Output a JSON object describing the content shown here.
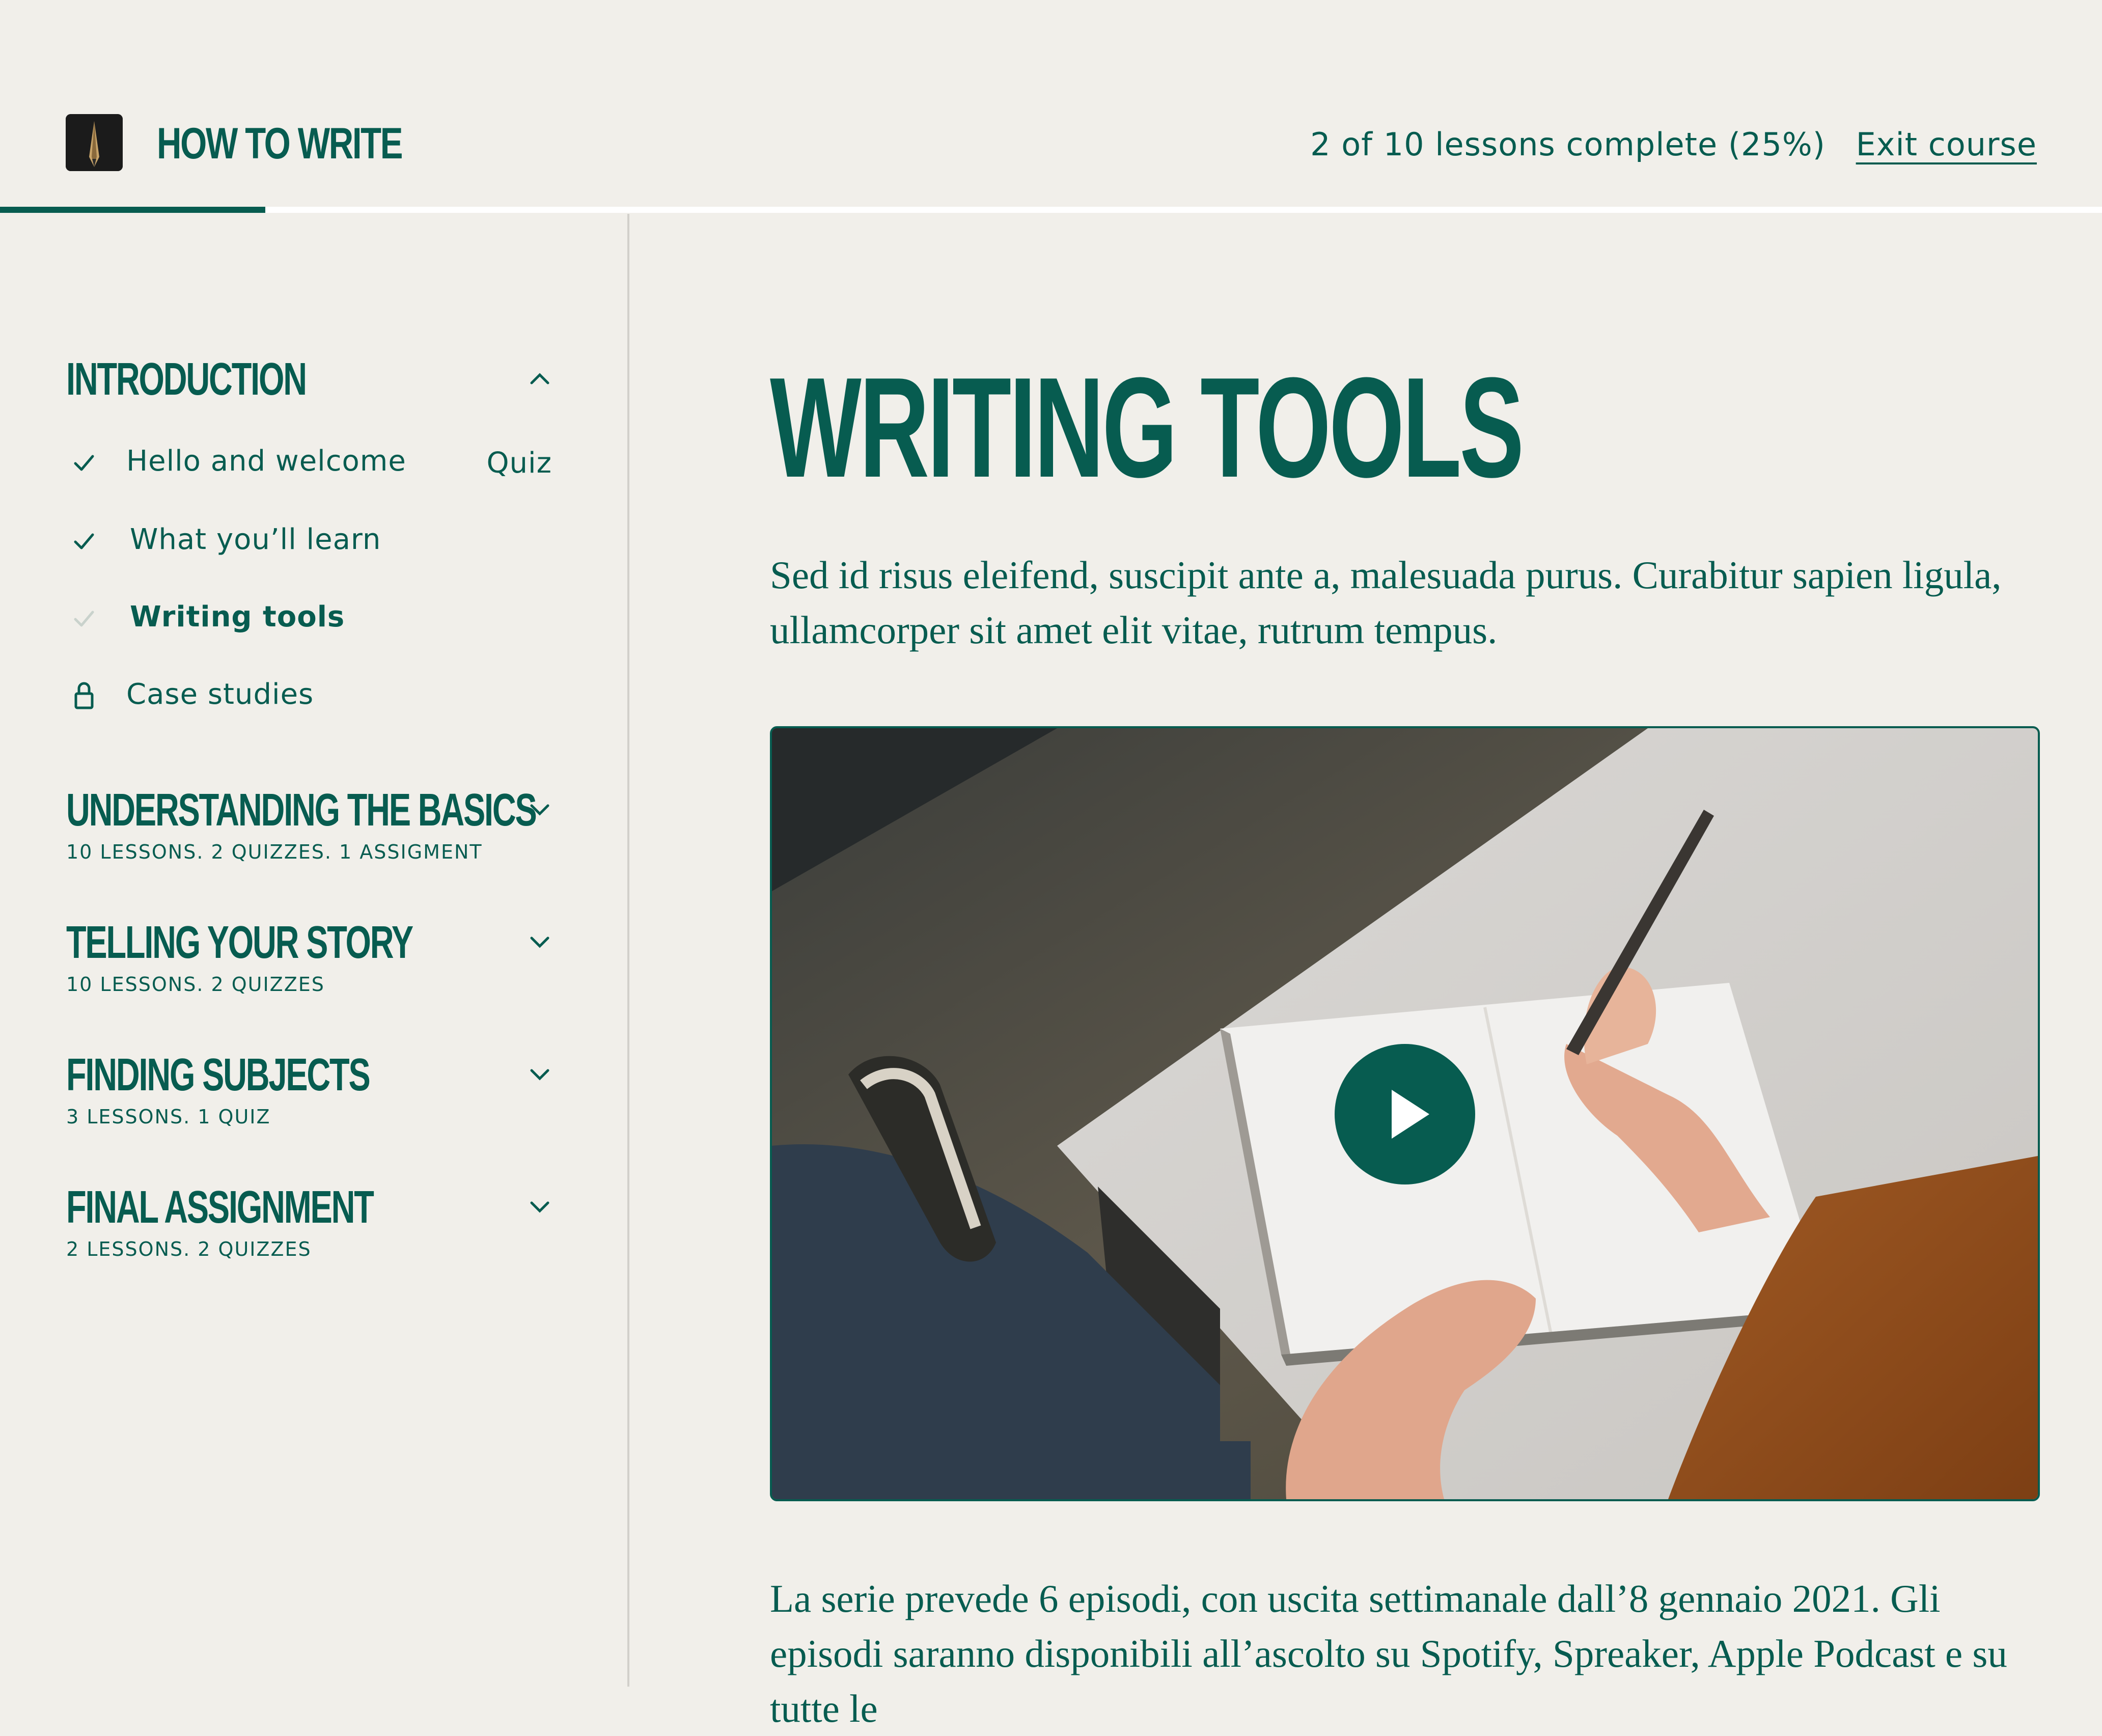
{
  "header": {
    "brand": "HOW TO WRITE",
    "progress_text": "2 of 10 lessons complete (25%)",
    "progress_fraction": 0.25,
    "exit_label": "Exit course"
  },
  "sidebar": {
    "sections": [
      {
        "title": "INTRODUCTION",
        "expanded": true,
        "lessons": [
          {
            "label": "Hello and welcome",
            "status": "complete",
            "tag": "Quiz"
          },
          {
            "label": "What you’ll learn",
            "status": "complete"
          },
          {
            "label": "Writing tools",
            "status": "current"
          },
          {
            "label": "Case studies",
            "status": "locked"
          }
        ]
      },
      {
        "title": "UNDERSTANDING THE BASICS",
        "subtitle": "10 LESSONS. 2 QUIZZES. 1 ASSIGMENT",
        "expanded": false
      },
      {
        "title": "TELLING YOUR STORY",
        "subtitle": "10 LESSONS. 2 QUIZZES",
        "expanded": false
      },
      {
        "title": "FINDING SUBJECTS",
        "subtitle": "3 LESSONS. 1 QUIZ",
        "expanded": false
      },
      {
        "title": "FINAL ASSIGNMENT",
        "subtitle": "2 LESSONS. 2 QUIZZES",
        "expanded": false
      }
    ]
  },
  "main": {
    "title": "WRITING TOOLS",
    "intro": "Sed id risus eleifend, suscipit ante a, malesuada purus. Curabitur sapien ligula, ullamcorper sit amet elit vitae, rutrum tempus.",
    "body": "La serie prevede 6 episodi, con uscita settimanale dall’8 gennaio 2021. Gli episodi saranno disponibili all’ascolto su Spotify, Spreaker, Apple Podcast e su tutte le"
  },
  "colors": {
    "accent": "#075c50",
    "background": "#f1efea",
    "divider": "#d2d0cb"
  },
  "icons": [
    "course-logo-icon",
    "chevron-up-icon",
    "chevron-down-icon",
    "check-icon",
    "lock-icon",
    "play-icon"
  ]
}
